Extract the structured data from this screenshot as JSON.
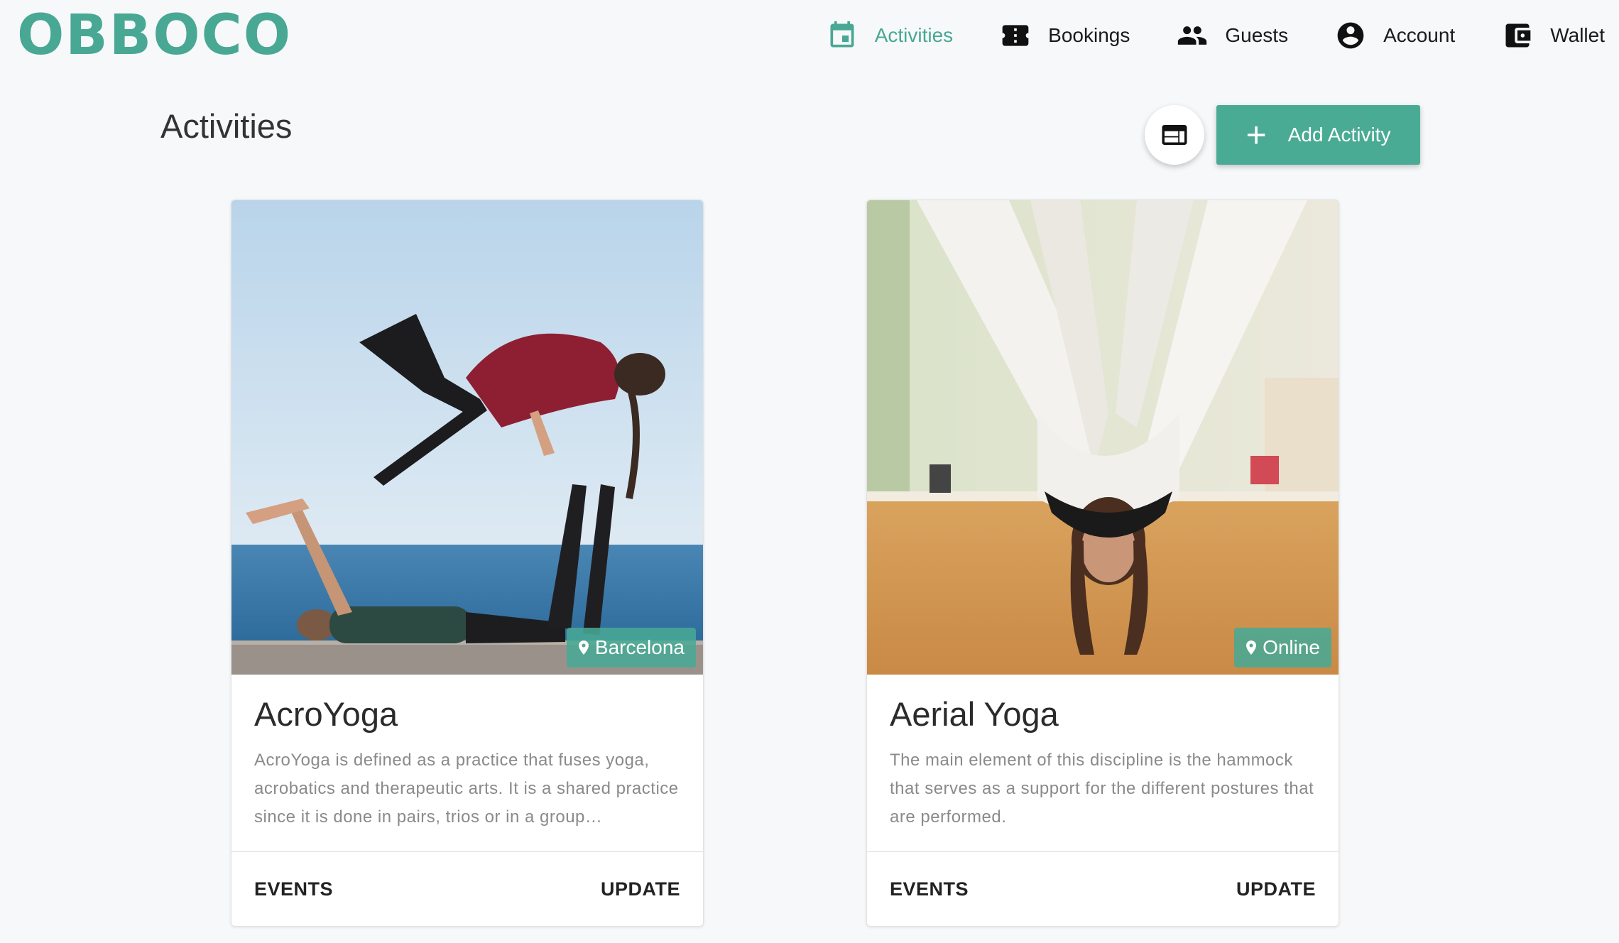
{
  "brand": {
    "logo": "OBBOCO",
    "color": "#48a894"
  },
  "nav": {
    "items": [
      {
        "label": "Activities",
        "icon": "calendar-icon",
        "active": true
      },
      {
        "label": "Bookings",
        "icon": "ticket-icon",
        "active": false
      },
      {
        "label": "Guests",
        "icon": "people-icon",
        "active": false
      },
      {
        "label": "Account",
        "icon": "account-circle-icon",
        "active": false
      },
      {
        "label": "Wallet",
        "icon": "wallet-icon",
        "active": false
      }
    ]
  },
  "page": {
    "title": "Activities",
    "layout_toggle_icon": "web-layout-icon",
    "add_button": {
      "label": "Add Activity",
      "icon": "plus-icon"
    }
  },
  "activities": [
    {
      "title": "AcroYoga",
      "description": "AcroYoga is defined as a practice that fuses yoga, acrobatics and therapeutic arts. It is a shared practice since it is done in pairs, trios or in a group…",
      "location": "Barcelona",
      "location_icon": "map-pin-icon",
      "actions": {
        "events": "EVENTS",
        "update": "UPDATE"
      }
    },
    {
      "title": "Aerial Yoga",
      "description": "The main element of this discipline is the hammock that serves as a support for the different postures that are performed.",
      "location": "Online",
      "location_icon": "map-pin-icon",
      "actions": {
        "events": "EVENTS",
        "update": "UPDATE"
      }
    }
  ]
}
